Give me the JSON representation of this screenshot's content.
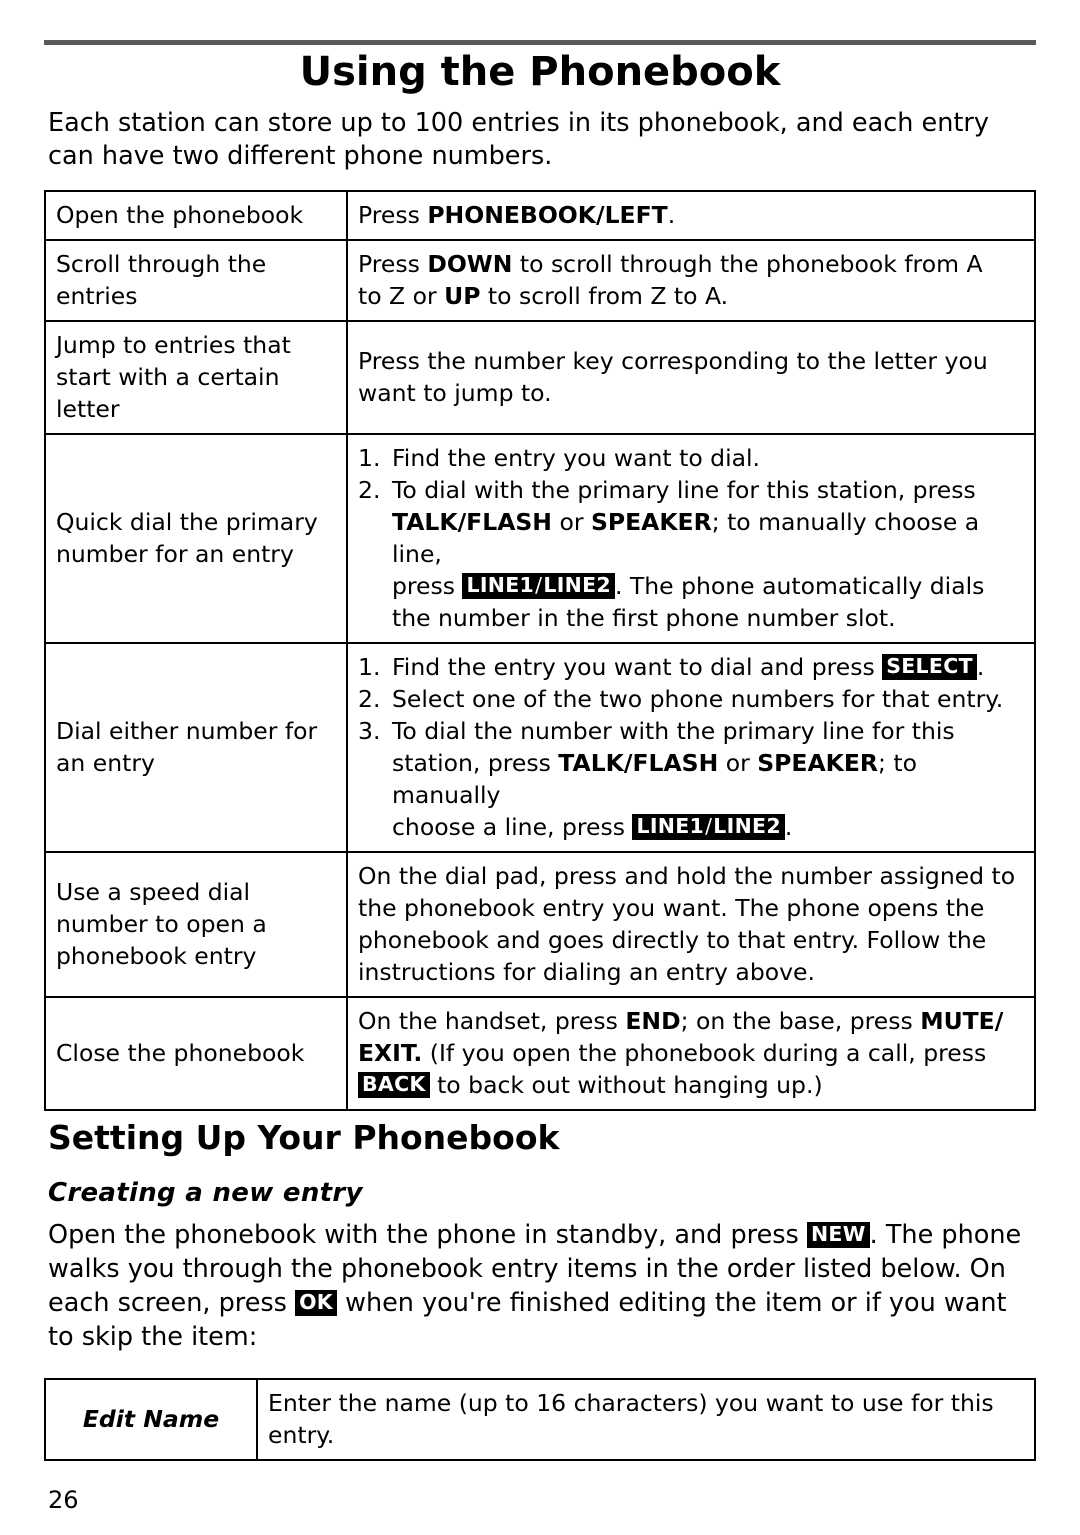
{
  "page": {
    "title": "Using the Phonebook",
    "intro": "Each station can store up to 100 entries in its phonebook, and each entry can have two different phone numbers.",
    "number": "26"
  },
  "main_table": {
    "rows": [
      {
        "label": "Open the phonebook",
        "instr_pre": "Press ",
        "instr_key": "PHONEBOOK/LEFT",
        "instr_post": "."
      },
      {
        "label": "Scroll through the entries",
        "line1_pre": "Press ",
        "line1_key": "DOWN",
        "line1_post": " to scroll through the phonebook from A",
        "line2_pre": "to Z or ",
        "line2_key": "UP",
        "line2_post": " to scroll from Z to A."
      },
      {
        "label": "Jump to entries that start with a certain letter",
        "text": "Press the number key corresponding to the letter you want to jump to."
      },
      {
        "label": "Quick dial the primary number for an entry",
        "step1": "Find the entry you want to dial.",
        "step2_a": "To dial with the primary line for this station, press ",
        "step2_k1": "TALK/FLASH",
        "step2_b": " or ",
        "step2_k2": "SPEAKER",
        "step2_c": "; to manually choose a line,",
        "step2_d": "press ",
        "step2_cap1": "LINE1",
        "step2_cap2": "LINE2",
        "step2_e": ". The phone automatically dials",
        "step2_f": "the number in the first phone number slot."
      },
      {
        "label": "Dial either number for an entry",
        "step1_pre": "Find the entry you want to dial and press ",
        "step1_cap": "SELECT",
        "step1_post": ".",
        "step2": "Select one of the two phone numbers for that entry.",
        "step3_a": "To dial the number with the primary line for this",
        "step3_b": "station, press ",
        "step3_k1": "TALK/FLASH",
        "step3_c": " or ",
        "step3_k2": "SPEAKER",
        "step3_d": "; to manually",
        "step3_e": "choose a line, press ",
        "step3_cap1": "LINE1",
        "step3_cap2": "LINE2",
        "step3_f": "."
      },
      {
        "label": "Use a speed dial number to open a phonebook entry",
        "text": "On the dial pad, press and hold the number assigned to the phonebook entry you want. The phone opens the phonebook and goes directly to that entry. Follow the instructions for dialing an entry above."
      },
      {
        "label": "Close the phonebook",
        "line1_a": "On the handset, press ",
        "line1_k1": "END",
        "line1_b": "; on the base, press ",
        "line1_k2": "MUTE/",
        "line2_k": "EXIT.",
        "line2_a": " (If you open the phonebook during a call, press",
        "line3_cap": "BACK",
        "line3_a": " to back out without hanging up.)"
      }
    ]
  },
  "section": {
    "heading": "Setting Up Your Phonebook",
    "subheading": "Creating a new entry",
    "para_a": "Open the phonebook with the phone in standby, and press ",
    "para_cap_new": "NEW",
    "para_b": ". The phone walks you through the phonebook entry items in the order listed below. On each screen, press ",
    "para_cap_ok": "OK",
    "para_c": " when you're finished editing the item or if you want to skip the item:"
  },
  "bottom_table": {
    "label": "Edit Name",
    "text": "Enter the name (up to 16 characters) you want to use for this entry."
  }
}
